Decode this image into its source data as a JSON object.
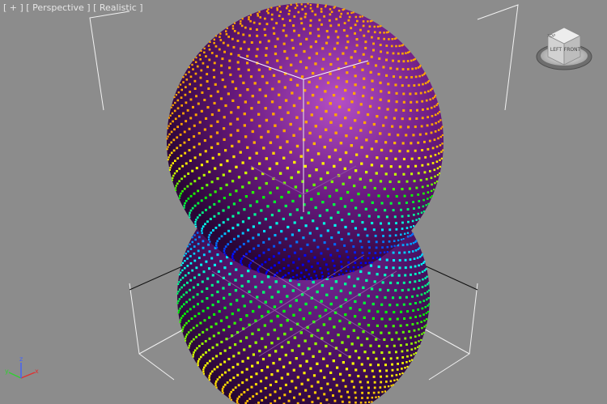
{
  "viewport": {
    "label": {
      "plus_menu": "[ + ]",
      "view_menu": "[ Perspective ]",
      "shading_menu": "[ Realistic ]"
    },
    "background_color": "#8c8c8c"
  },
  "viewcube": {
    "faces": {
      "front": "LEFT",
      "right": "FRONT",
      "top": "TOP"
    }
  },
  "axis_tripod": {
    "x": "x",
    "y": "y",
    "z": "z"
  },
  "colors": {
    "sphere_base": "#6a1a80",
    "particle_gradient": [
      "#ffa500",
      "#ffff00",
      "#00ff00",
      "#00ffff",
      "#0000ff"
    ],
    "axis_x": "#e03030",
    "axis_y": "#30d030",
    "axis_z": "#4060ff"
  }
}
